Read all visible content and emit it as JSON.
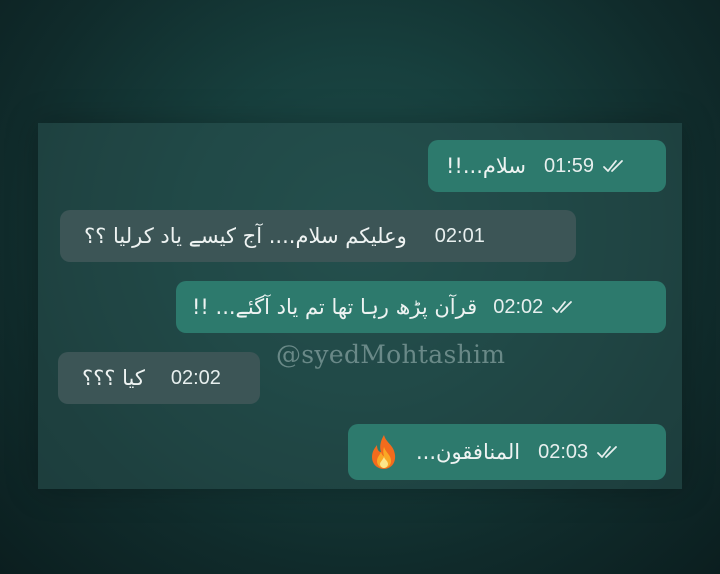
{
  "watermark": "@syedMohtashim",
  "messages": [
    {
      "direction": "outgoing",
      "text": "سلام...!!",
      "time": "01:59",
      "status_icon": "double-check-icon"
    },
    {
      "direction": "incoming",
      "text": "وعلیکم سلام.... آج کیسے یاد کرلیا ؟؟",
      "time": "02:01"
    },
    {
      "direction": "outgoing",
      "text": "قرآن پڑھ رہا تھا تم یاد آگئے... !!",
      "time": "02:02",
      "status_icon": "double-check-icon"
    },
    {
      "direction": "incoming",
      "text": "کیا ؟؟؟",
      "time": "02:02"
    },
    {
      "direction": "outgoing",
      "text": "المنافقون...",
      "emoji_icon": "fire-icon",
      "time": "02:03",
      "status_icon": "double-check-icon"
    }
  ],
  "colors": {
    "outgoing_bubble": "#2d7a6d",
    "incoming_bubble": "#3c5556",
    "panel": "#2a5250",
    "background": "#173f3d"
  }
}
